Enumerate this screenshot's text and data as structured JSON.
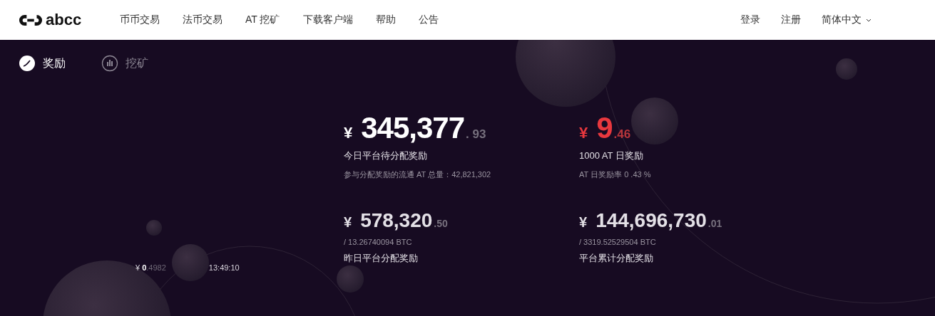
{
  "header": {
    "logo": "abcc",
    "nav": [
      {
        "label": "币币交易"
      },
      {
        "label": "法币交易"
      },
      {
        "label": "AT 挖矿"
      },
      {
        "label": "下载客户端"
      },
      {
        "label": "帮助"
      },
      {
        "label": "公告"
      }
    ],
    "login": "登录",
    "register": "注册",
    "language": "简体中文"
  },
  "tabs": [
    {
      "label": "奖励",
      "selected": true
    },
    {
      "label": "挖矿",
      "selected": false
    }
  ],
  "ticker": {
    "currency": "¥",
    "price_integer": "0",
    "price_decimal": ".4982",
    "time": "13:49:10"
  },
  "stats": [
    {
      "kind": "primary",
      "highlight": false,
      "currency": "¥",
      "integer": "345,377",
      "decimal": ". 93",
      "label": "今日平台待分配奖励",
      "note": "参与分配奖励的流通 AT 总量：42,821,302"
    },
    {
      "kind": "primary",
      "highlight": true,
      "currency": "¥",
      "integer": "9",
      "decimal": ".46",
      "label": "1000 AT 日奖励",
      "note": "AT 日奖励率 0 .43 %"
    },
    {
      "kind": "secondary",
      "highlight": false,
      "currency": "¥",
      "integer": "578,320",
      "decimal": ".50",
      "note": "/ 13.26740094 BTC",
      "label": "昨日平台分配奖励"
    },
    {
      "kind": "secondary",
      "highlight": false,
      "currency": "¥",
      "integer": "144,696,730",
      "decimal": ".01",
      "note": "/ 3319.52529504 BTC",
      "label": "平台累计分配奖励"
    }
  ]
}
